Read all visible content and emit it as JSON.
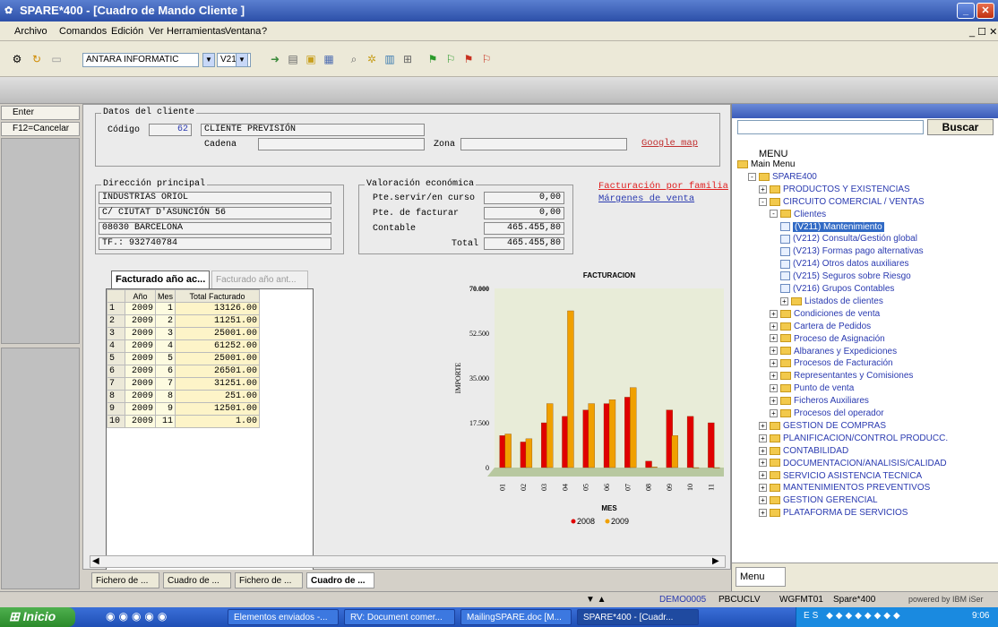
{
  "window": {
    "title": "SPARE*400 - [Cuadro de Mando Cliente ]"
  },
  "menu": [
    "Archivo",
    "Comandos",
    "Edición",
    "Ver",
    "Herramientas",
    "Ventana",
    "?"
  ],
  "toolbar": {
    "company": "ANTARA INFORMATIC",
    "program": "V212"
  },
  "left": {
    "enter": "Enter",
    "cancel": "F12=Cancelar"
  },
  "cliente": {
    "legend": "Datos del cliente",
    "codigo_label": "Código",
    "codigo": "62",
    "nombre": "CLIENTE PREVISIÓN",
    "cadena_label": "Cadena",
    "zona_label": "Zona",
    "google": "Google map"
  },
  "direccion": {
    "legend": "Dirección principal",
    "lines": [
      "INDUSTRIAS ORIOL",
      "C/ CIUTAT D'ASUNCIÓN 56",
      "08030  BARCELONA",
      "TF.: 932740784"
    ]
  },
  "valoracion": {
    "legend": "Valoración económica",
    "rows": [
      {
        "label": "Pte.servir/en curso",
        "value": "0,00"
      },
      {
        "label": "Pte. de facturar",
        "value": "0,00"
      },
      {
        "label": "Contable",
        "value": "465.455,80"
      },
      {
        "label": "Total",
        "value": "465.455,80"
      }
    ]
  },
  "links": {
    "familia": "Facturación por familia",
    "margenes": "Márgenes de venta"
  },
  "tabs": {
    "active": "Facturado año ac...",
    "inactive": "Facturado año ant..."
  },
  "grid": {
    "headers": [
      "Año",
      "Mes",
      "Total Facturado"
    ],
    "rows": [
      [
        "1",
        "2009",
        "1",
        "13126.00"
      ],
      [
        "2",
        "2009",
        "2",
        "11251.00"
      ],
      [
        "3",
        "2009",
        "3",
        "25001.00"
      ],
      [
        "4",
        "2009",
        "4",
        "61252.00"
      ],
      [
        "5",
        "2009",
        "5",
        "25001.00"
      ],
      [
        "6",
        "2009",
        "6",
        "26501.00"
      ],
      [
        "7",
        "2009",
        "7",
        "31251.00"
      ],
      [
        "8",
        "2009",
        "8",
        "251.00"
      ],
      [
        "9",
        "2009",
        "9",
        "12501.00"
      ],
      [
        "10",
        "2009",
        "11",
        "1.00"
      ]
    ]
  },
  "chart_data": {
    "type": "bar",
    "title": "FACTURACION",
    "xlabel": "MES",
    "ylabel": "IMPORTE",
    "categories": [
      "01",
      "02",
      "03",
      "04",
      "05",
      "06",
      "07",
      "08",
      "09",
      "10",
      "11"
    ],
    "yticks": [
      "0",
      "17.500",
      "35.000",
      "52.500",
      "70.000"
    ],
    "ylim": [
      0,
      70000
    ],
    "series": [
      {
        "name": "2008",
        "color": "#e00000",
        "values": [
          12500,
          10000,
          17500,
          20000,
          22500,
          25000,
          27500,
          2500,
          22500,
          20000,
          17500
        ]
      },
      {
        "name": "2009",
        "color": "#f0a000",
        "values": [
          13126,
          11251,
          25001,
          61252,
          25001,
          26501,
          31251,
          251,
          12501,
          0,
          1
        ]
      }
    ],
    "legend_position": "bottom"
  },
  "bottom_tabs": [
    "Fichero de ...",
    "Cuadro de ...",
    "Fichero de ...",
    "Cuadro de ..."
  ],
  "tree": {
    "search_button": "Buscar",
    "header": "MENU",
    "items": [
      {
        "label": "Main Menu"
      },
      {
        "label": "SPARE400"
      },
      {
        "label": "PRODUCTOS Y EXISTENCIAS"
      },
      {
        "label": "CIRCUITO COMERCIAL / VENTAS"
      },
      {
        "label": "Clientes"
      },
      {
        "label": "(V211) Mantenimiento"
      },
      {
        "label": "(V212) Consulta/Gestión global"
      },
      {
        "label": "(V213) Formas pago alternativas"
      },
      {
        "label": "(V214) Otros datos auxiliares"
      },
      {
        "label": "(V215) Seguros sobre Riesgo"
      },
      {
        "label": "(V216) Grupos Contables"
      },
      {
        "label": "Listados de clientes"
      },
      {
        "label": "Condiciones de venta"
      },
      {
        "label": "Cartera de Pedidos"
      },
      {
        "label": "Proceso de Asignación"
      },
      {
        "label": "Albaranes y Expediciones"
      },
      {
        "label": "Procesos de Facturación"
      },
      {
        "label": "Representantes y Comisiones"
      },
      {
        "label": "Punto de venta"
      },
      {
        "label": "Ficheros Auxiliares"
      },
      {
        "label": "Procesos del operador"
      },
      {
        "label": "GESTION DE COMPRAS"
      },
      {
        "label": "PLANIFICACION/CONTROL PRODUCC."
      },
      {
        "label": "CONTABILIDAD"
      },
      {
        "label": "DOCUMENTACION/ANALISIS/CALIDAD"
      },
      {
        "label": "SERVICIO ASISTENCIA TECNICA"
      },
      {
        "label": "MANTENIMIENTOS PREVENTIVOS"
      },
      {
        "label": "GESTION GERENCIAL"
      },
      {
        "label": "PLATAFORMA DE SERVICIOS"
      }
    ],
    "bottom_tab": "Menu"
  },
  "status": {
    "a": "DEMO0005",
    "b": "PBCUCLV",
    "c": "WGFMT01",
    "d": "Spare*400",
    "e": "powered by IBM iSer"
  },
  "taskbar": {
    "start": "Inicio",
    "tasks": [
      "Elementos enviados -...",
      "RV: Document comer...",
      "MailingSPARE.doc [M...",
      "SPARE*400 - [Cuadr..."
    ],
    "clock": "9:06"
  }
}
